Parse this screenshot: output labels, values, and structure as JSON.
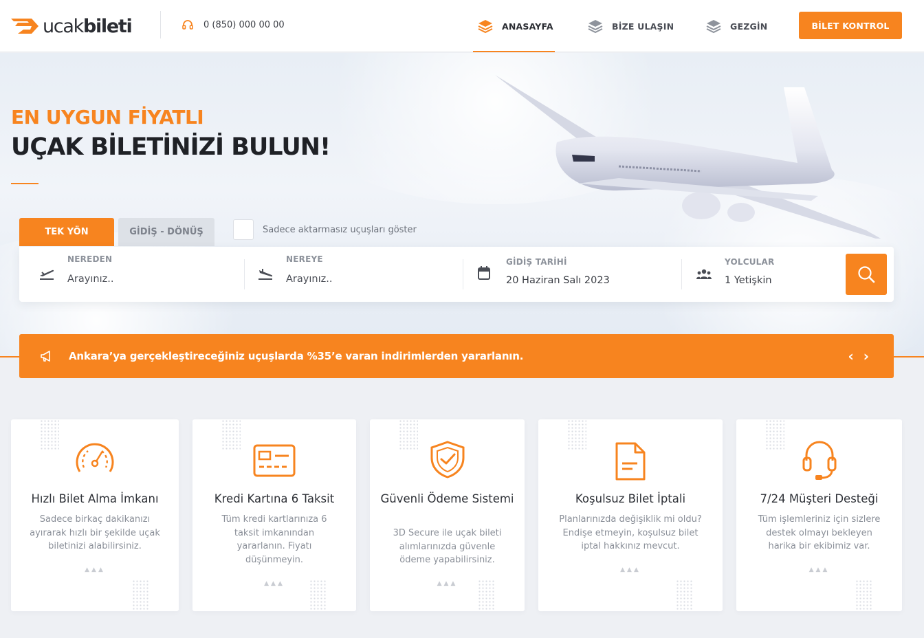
{
  "brand": {
    "name_light": "ucak",
    "name_bold": "bileti",
    "accent": "#f7841f"
  },
  "header": {
    "phone": "0 (850) 000 00 00",
    "nav": [
      {
        "label": "ANASAYFA",
        "active": true
      },
      {
        "label": "BİZE ULAŞIN",
        "active": false
      },
      {
        "label": "GEZGİN",
        "active": false
      }
    ],
    "cta": "BİLET KONTROL"
  },
  "hero": {
    "subtitle": "EN UYGUN FİYATLI",
    "title": "UÇAK BİLETİNİZİ BULUN!"
  },
  "search": {
    "tabs": [
      {
        "label": "TEK YÖN",
        "active": true
      },
      {
        "label": "GİDİŞ - DÖNÜŞ",
        "active": false
      }
    ],
    "nonstop_label": "Sadece aktarmasız uçuşları göster",
    "from": {
      "label": "NEREDEN",
      "placeholder": "Arayınız.."
    },
    "to": {
      "label": "NEREYE",
      "placeholder": "Arayınız.."
    },
    "date": {
      "label": "GİDİŞ TARİHİ",
      "value": "20 Haziran Salı 2023"
    },
    "passengers": {
      "label": "YOLCULAR",
      "value": "1 Yetişkin"
    }
  },
  "promo": {
    "text": "Ankara’ya gerçekleştireceğiniz uçuşlarda %35’e varan indirimlerden yararlanın.",
    "prev": "‹",
    "next": "›"
  },
  "features": [
    {
      "icon": "speedometer-icon",
      "title": "Hızlı Bilet Alma İmkanı",
      "desc": "Sadece birkaç dakikanızı ayırarak hızlı bir şekilde uçak biletinizi alabilirsiniz."
    },
    {
      "icon": "credit-card-icon",
      "title": "Kredi Kartına 6 Taksit",
      "desc": "Tüm kredi kartlarınıza 6 taksit imkanından yararlanın. Fiyatı düşünmeyin."
    },
    {
      "icon": "shield-check-icon",
      "title": "Güvenli Ödeme Sistemi",
      "desc": "3D Secure ile uçak bileti alımlarınızda güvenle ödeme yapabilirsiniz."
    },
    {
      "icon": "document-icon",
      "title": "Koşulsuz Bilet İptali",
      "desc": "Planlarınızda değişiklik mi oldu? Endişe etmeyin, koşulsuz bilet iptal hakkınız mevcut."
    },
    {
      "icon": "headset-icon",
      "title": "7/24 Müşteri Desteği",
      "desc": "Tüm işlemleriniz için sizlere destek olmayı bekleyen harika bir ekibimiz var."
    }
  ]
}
